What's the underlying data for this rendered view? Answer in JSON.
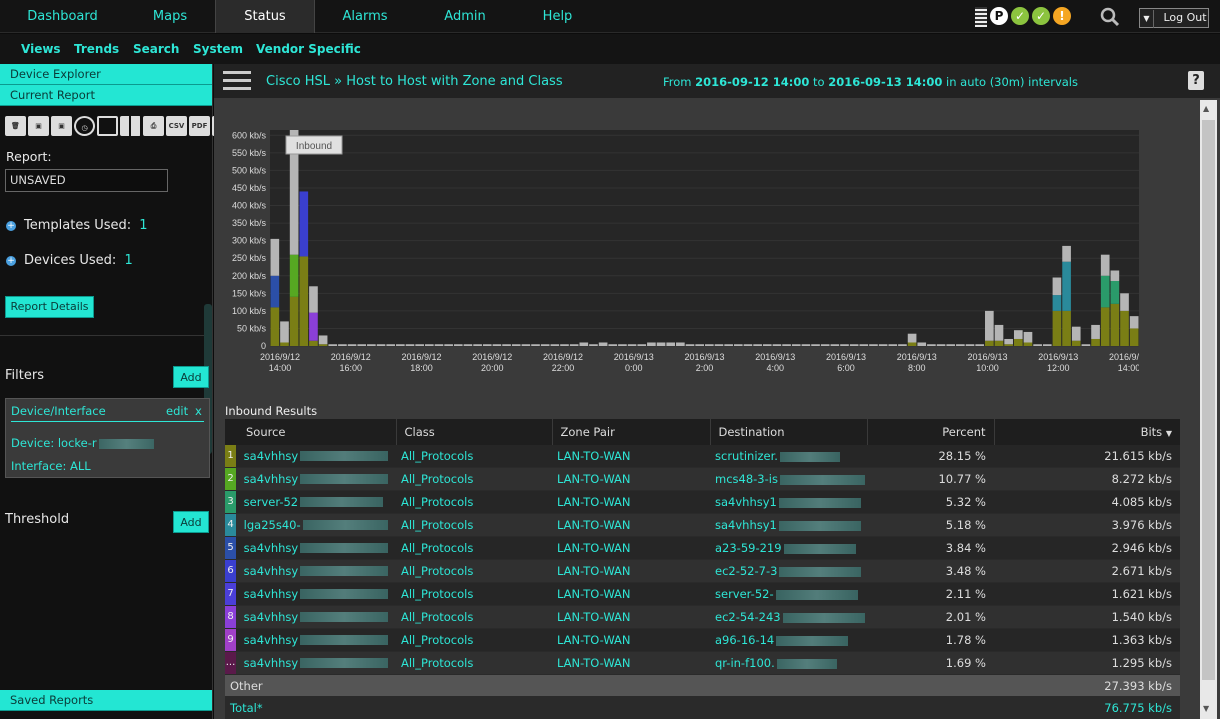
{
  "topnav": {
    "tabs": [
      "Dashboard",
      "Maps",
      "Status",
      "Alarms",
      "Admin",
      "Help"
    ],
    "logout": "Log Out",
    "status_icon_p": "P"
  },
  "subnav": [
    "Views",
    "Trends",
    "Search",
    "System",
    "Vendor Specific"
  ],
  "sidebar": {
    "device_explorer": "Device Explorer",
    "current_report": "Current Report",
    "report_label": "Report:",
    "report_value": "UNSAVED",
    "templates_label": "Templates Used:",
    "templates_count": "1",
    "devices_label": "Devices Used:",
    "devices_count": "1",
    "report_details": "Report Details",
    "filters_label": "Filters",
    "add": "Add",
    "filter_title": "Device/Interface",
    "filter_edit": "edit",
    "filter_close": "x",
    "filter_device": "Device: locke-r",
    "filter_interface": "Interface: ALL",
    "threshold_label": "Threshold",
    "saved_reports": "Saved Reports",
    "toolbar_icons": [
      "trash-icon",
      "save-icon",
      "save-as-icon",
      "clock-icon",
      "grid-icon",
      "grid-small-icon",
      "print-icon",
      "csv-icon",
      "pdf-icon",
      "email-icon"
    ],
    "csv": "CSV",
    "pdf": "PDF",
    "email": "@"
  },
  "header": {
    "crumb_root": "Cisco HSL",
    "crumb_sep": "»",
    "crumb_page": "Host to Host with Zone and Class",
    "from_label": "From",
    "from_date": "2016-09-12 14:00",
    "to_label": "to",
    "to_date": "2016-09-13 14:00",
    "interval": "in auto (30m) intervals",
    "help": "?"
  },
  "chart_data": {
    "type": "bar",
    "legend_button": "Inbound",
    "y_ticks": [
      "600 kb/s",
      "550 kb/s",
      "500 kb/s",
      "450 kb/s",
      "400 kb/s",
      "350 kb/s",
      "300 kb/s",
      "250 kb/s",
      "200 kb/s",
      "150 kb/s",
      "100 kb/s",
      "50 kb/s",
      "0"
    ],
    "x_ticks": [
      [
        "2016/9/12",
        "14:00"
      ],
      [
        "2016/9/12",
        "16:00"
      ],
      [
        "2016/9/12",
        "18:00"
      ],
      [
        "2016/9/12",
        "20:00"
      ],
      [
        "2016/9/12",
        "22:00"
      ],
      [
        "2016/9/13",
        "0:00"
      ],
      [
        "2016/9/13",
        "2:00"
      ],
      [
        "2016/9/13",
        "4:00"
      ],
      [
        "2016/9/13",
        "6:00"
      ],
      [
        "2016/9/13",
        "8:00"
      ],
      [
        "2016/9/13",
        "10:00"
      ],
      [
        "2016/9/13",
        "12:00"
      ],
      [
        "2016/9/13",
        "14:00"
      ]
    ],
    "ylim": [
      0,
      615
    ],
    "totals": [
      305,
      70,
      615,
      310,
      170,
      30,
      5,
      5,
      5,
      5,
      5,
      5,
      5,
      5,
      5,
      5,
      5,
      5,
      5,
      5,
      5,
      5,
      5,
      5,
      5,
      5,
      5,
      5,
      5,
      5,
      5,
      5,
      10,
      5,
      10,
      5,
      5,
      5,
      5,
      10,
      10,
      10,
      10,
      5,
      5,
      5,
      5,
      5,
      5,
      5,
      5,
      5,
      5,
      5,
      5,
      5,
      5,
      5,
      5,
      5,
      5,
      5,
      5,
      5,
      5,
      5,
      35,
      10,
      5,
      5,
      5,
      5,
      5,
      5,
      100,
      60,
      20,
      45,
      40,
      5,
      5,
      195,
      285,
      55,
      5,
      60,
      260,
      215,
      150,
      85
    ],
    "series": [
      {
        "name": "1",
        "color": "#7a7e15",
        "values": [
          110,
          10,
          140,
          255,
          15,
          5,
          0,
          0,
          0,
          0,
          0,
          0,
          0,
          0,
          0,
          0,
          0,
          0,
          0,
          0,
          0,
          0,
          0,
          0,
          0,
          0,
          0,
          0,
          0,
          0,
          0,
          0,
          0,
          0,
          0,
          0,
          0,
          0,
          0,
          0,
          0,
          0,
          0,
          0,
          0,
          0,
          0,
          0,
          0,
          0,
          0,
          0,
          0,
          0,
          0,
          0,
          0,
          0,
          0,
          0,
          0,
          0,
          0,
          0,
          0,
          0,
          10,
          0,
          0,
          0,
          0,
          0,
          0,
          0,
          15,
          15,
          5,
          20,
          10,
          0,
          0,
          100,
          100,
          15,
          0,
          20,
          110,
          120,
          100,
          50
        ]
      },
      {
        "name": "2",
        "color": "#56a822",
        "values": [
          0,
          0,
          120,
          0,
          0,
          0,
          0,
          0,
          0,
          0,
          0,
          0,
          0,
          0,
          0,
          0,
          0,
          0,
          0,
          0,
          0,
          0,
          0,
          0,
          0,
          0,
          0,
          0,
          0,
          0,
          0,
          0,
          0,
          0,
          0,
          0,
          0,
          0,
          0,
          0,
          0,
          0,
          0,
          0,
          0,
          0,
          0,
          0,
          0,
          0,
          0,
          0,
          0,
          0,
          0,
          0,
          0,
          0,
          0,
          0,
          0,
          0,
          0,
          0,
          0,
          0,
          0,
          0,
          0,
          0,
          0,
          0,
          0,
          0,
          0,
          0,
          0,
          0,
          0,
          0,
          0,
          0,
          0,
          0,
          0,
          0,
          0,
          0,
          0,
          0
        ]
      },
      {
        "name": "3",
        "color": "#2a9b6a",
        "values": [
          0,
          0,
          0,
          0,
          0,
          0,
          0,
          0,
          0,
          0,
          0,
          0,
          0,
          0,
          0,
          0,
          0,
          0,
          0,
          0,
          0,
          0,
          0,
          0,
          0,
          0,
          0,
          0,
          0,
          0,
          0,
          0,
          0,
          0,
          0,
          0,
          0,
          0,
          0,
          0,
          0,
          0,
          0,
          0,
          0,
          0,
          0,
          0,
          0,
          0,
          0,
          0,
          0,
          0,
          0,
          0,
          0,
          0,
          0,
          0,
          0,
          0,
          0,
          0,
          0,
          0,
          0,
          0,
          0,
          0,
          0,
          0,
          0,
          0,
          0,
          0,
          0,
          0,
          0,
          0,
          0,
          0,
          0,
          0,
          0,
          0,
          90,
          65,
          0,
          0
        ]
      },
      {
        "name": "4",
        "color": "#2a8a9b",
        "values": [
          0,
          0,
          0,
          0,
          0,
          0,
          0,
          0,
          0,
          0,
          0,
          0,
          0,
          0,
          0,
          0,
          0,
          0,
          0,
          0,
          0,
          0,
          0,
          0,
          0,
          0,
          0,
          0,
          0,
          0,
          0,
          0,
          0,
          0,
          0,
          0,
          0,
          0,
          0,
          0,
          0,
          0,
          0,
          0,
          0,
          0,
          0,
          0,
          0,
          0,
          0,
          0,
          0,
          0,
          0,
          0,
          0,
          0,
          0,
          0,
          0,
          0,
          0,
          0,
          0,
          0,
          0,
          0,
          0,
          0,
          0,
          0,
          0,
          0,
          0,
          0,
          0,
          0,
          0,
          0,
          0,
          45,
          140,
          0,
          0,
          0,
          0,
          0,
          0,
          0
        ]
      },
      {
        "name": "5",
        "color": "#2b4fa8",
        "values": [
          90,
          0,
          0,
          0,
          0,
          0,
          0,
          0,
          0,
          0,
          0,
          0,
          0,
          0,
          0,
          0,
          0,
          0,
          0,
          0,
          0,
          0,
          0,
          0,
          0,
          0,
          0,
          0,
          0,
          0,
          0,
          0,
          0,
          0,
          0,
          0,
          0,
          0,
          0,
          0,
          0,
          0,
          0,
          0,
          0,
          0,
          0,
          0,
          0,
          0,
          0,
          0,
          0,
          0,
          0,
          0,
          0,
          0,
          0,
          0,
          0,
          0,
          0,
          0,
          0,
          0,
          0,
          0,
          0,
          0,
          0,
          0,
          0,
          0,
          0,
          0,
          0,
          0,
          0,
          0,
          0,
          0,
          0,
          0,
          0,
          0,
          0,
          0,
          0,
          0
        ]
      },
      {
        "name": "6",
        "color": "#3a3fcf",
        "values": [
          0,
          0,
          0,
          0,
          0,
          0,
          0,
          0,
          0,
          0,
          0,
          0,
          0,
          0,
          0,
          0,
          0,
          0,
          0,
          0,
          0,
          0,
          0,
          0,
          0,
          0,
          0,
          0,
          0,
          0,
          0,
          0,
          0,
          0,
          0,
          0,
          0,
          0,
          0,
          0,
          0,
          0,
          0,
          0,
          0,
          0,
          0,
          0,
          0,
          0,
          0,
          0,
          0,
          0,
          0,
          0,
          0,
          0,
          0,
          0,
          0,
          0,
          0,
          0,
          0,
          0,
          0,
          0,
          0,
          0,
          0,
          0,
          0,
          0,
          0,
          0,
          0,
          0,
          0,
          0,
          0,
          0,
          0,
          0,
          0,
          0,
          0,
          0,
          0,
          0
        ]
      },
      {
        "name": "7",
        "color": "#3f3fd8",
        "values": [
          0,
          0,
          0,
          0,
          0,
          0,
          0,
          0,
          0,
          0,
          0,
          0,
          0,
          0,
          0,
          0,
          0,
          0,
          0,
          0,
          0,
          0,
          0,
          0,
          0,
          0,
          0,
          0,
          0,
          0,
          0,
          0,
          0,
          0,
          0,
          0,
          0,
          0,
          0,
          0,
          0,
          0,
          0,
          0,
          0,
          0,
          0,
          0,
          0,
          0,
          0,
          0,
          0,
          0,
          0,
          0,
          0,
          0,
          0,
          0,
          0,
          0,
          0,
          0,
          0,
          0,
          0,
          0,
          0,
          0,
          0,
          0,
          0,
          0,
          0,
          0,
          0,
          0,
          0,
          0,
          0,
          0,
          0,
          0,
          0,
          0,
          0,
          0,
          0,
          0
        ]
      },
      {
        "name": "8",
        "color": "#8b3fd8",
        "values": [
          0,
          0,
          0,
          0,
          80,
          0,
          0,
          0,
          0,
          0,
          0,
          0,
          0,
          0,
          0,
          0,
          0,
          0,
          0,
          0,
          0,
          0,
          0,
          0,
          0,
          0,
          0,
          0,
          0,
          0,
          0,
          0,
          0,
          0,
          0,
          0,
          0,
          0,
          0,
          0,
          0,
          0,
          0,
          0,
          0,
          0,
          0,
          0,
          0,
          0,
          0,
          0,
          0,
          0,
          0,
          0,
          0,
          0,
          0,
          0,
          0,
          0,
          0,
          0,
          0,
          0,
          0,
          0,
          0,
          0,
          0,
          0,
          0,
          0,
          0,
          0,
          0,
          0,
          0,
          0,
          0,
          0,
          0,
          0,
          0,
          0,
          0,
          0,
          0,
          0
        ]
      },
      {
        "name": "9",
        "color": "#a040c8",
        "values": [
          0,
          0,
          0,
          0,
          0,
          0,
          0,
          0,
          0,
          0,
          0,
          0,
          0,
          0,
          0,
          0,
          0,
          0,
          0,
          0,
          0,
          0,
          0,
          0,
          0,
          0,
          0,
          0,
          0,
          0,
          0,
          0,
          0,
          0,
          0,
          0,
          0,
          0,
          0,
          0,
          0,
          0,
          0,
          0,
          0,
          0,
          0,
          0,
          0,
          0,
          0,
          0,
          0,
          0,
          0,
          0,
          0,
          0,
          0,
          0,
          0,
          0,
          0,
          0,
          0,
          0,
          0,
          0,
          0,
          0,
          0,
          0,
          0,
          0,
          0,
          0,
          0,
          0,
          0,
          0,
          0,
          0,
          0,
          0,
          0,
          0,
          0,
          0,
          0,
          0
        ]
      }
    ],
    "other_color": "#b5b5b5",
    "blue_peak": {
      "values_index": 3,
      "blue": 185
    }
  },
  "results": {
    "title": "Inbound Results",
    "columns": [
      "Source",
      "Class",
      "Zone Pair",
      "Destination",
      "Percent",
      "Bits"
    ],
    "sort_indicator": "▼",
    "rows": [
      {
        "rank": "1",
        "color": "#7a7e15",
        "source": "sa4vhhsy",
        "class": "All_Protocols",
        "zone": "LAN-TO-WAN",
        "dest": "scrutinizer.",
        "percent": "28.15 %",
        "bits": "21.615 kb/s"
      },
      {
        "rank": "2",
        "color": "#56a822",
        "source": "sa4vhhsy",
        "class": "All_Protocols",
        "zone": "LAN-TO-WAN",
        "dest": "mcs48-3-is",
        "percent": "10.77 %",
        "bits": "8.272 kb/s"
      },
      {
        "rank": "3",
        "color": "#2a9b6a",
        "source": "server-52",
        "class": "All_Protocols",
        "zone": "LAN-TO-WAN",
        "dest": "sa4vhhsy1",
        "percent": "5.32 %",
        "bits": "4.085 kb/s"
      },
      {
        "rank": "4",
        "color": "#2a8a9b",
        "source": "lga25s40-",
        "class": "All_Protocols",
        "zone": "LAN-TO-WAN",
        "dest": "sa4vhhsy1",
        "percent": "5.18 %",
        "bits": "3.976 kb/s"
      },
      {
        "rank": "5",
        "color": "#2b4fa8",
        "source": "sa4vhhsy",
        "class": "All_Protocols",
        "zone": "LAN-TO-WAN",
        "dest": "a23-59-219",
        "percent": "3.84 %",
        "bits": "2.946 kb/s"
      },
      {
        "rank": "6",
        "color": "#3a3fcf",
        "source": "sa4vhhsy",
        "class": "All_Protocols",
        "zone": "LAN-TO-WAN",
        "dest": "ec2-52-7-3",
        "percent": "3.48 %",
        "bits": "2.671 kb/s"
      },
      {
        "rank": "7",
        "color": "#4b3fd8",
        "source": "sa4vhhsy",
        "class": "All_Protocols",
        "zone": "LAN-TO-WAN",
        "dest": "server-52-",
        "percent": "2.11 %",
        "bits": "1.621 kb/s"
      },
      {
        "rank": "8",
        "color": "#8b3fd8",
        "source": "sa4vhhsy",
        "class": "All_Protocols",
        "zone": "LAN-TO-WAN",
        "dest": "ec2-54-243",
        "percent": "2.01 %",
        "bits": "1.540 kb/s"
      },
      {
        "rank": "9",
        "color": "#a040c8",
        "source": "sa4vhhsy",
        "class": "All_Protocols",
        "zone": "LAN-TO-WAN",
        "dest": "a96-16-14",
        "percent": "1.78 %",
        "bits": "1.363 kb/s"
      },
      {
        "rank": "...",
        "color": "#5a1a4a",
        "source": "sa4vhhsy",
        "class": "All_Protocols",
        "zone": "LAN-TO-WAN",
        "dest": "qr-in-f100.",
        "percent": "1.69 %",
        "bits": "1.295 kb/s"
      }
    ],
    "other_label": "Other",
    "other_bits": "27.393 kb/s",
    "total_label": "Total*",
    "total_bits": "76.775 kb/s"
  }
}
